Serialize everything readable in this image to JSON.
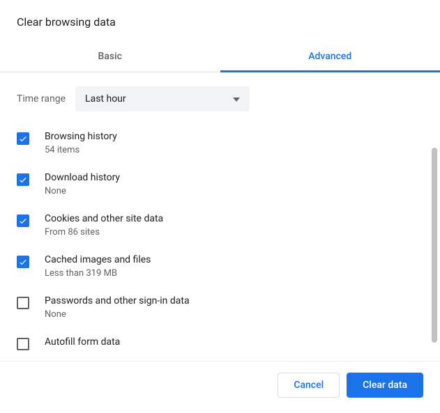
{
  "title": "Clear browsing data",
  "tabs": {
    "basic": "Basic",
    "advanced": "Advanced"
  },
  "timerange": {
    "label": "Time range",
    "value": "Last hour"
  },
  "items": [
    {
      "label": "Browsing history",
      "sub": "54 items",
      "checked": true
    },
    {
      "label": "Download history",
      "sub": "None",
      "checked": true
    },
    {
      "label": "Cookies and other site data",
      "sub": "From 86 sites",
      "checked": true
    },
    {
      "label": "Cached images and files",
      "sub": "Less than 319 MB",
      "checked": true
    },
    {
      "label": "Passwords and other sign-in data",
      "sub": "None",
      "checked": false
    },
    {
      "label": "Autofill form data",
      "sub": "",
      "checked": false
    }
  ],
  "footer": {
    "cancel": "Cancel",
    "clear": "Clear data"
  }
}
